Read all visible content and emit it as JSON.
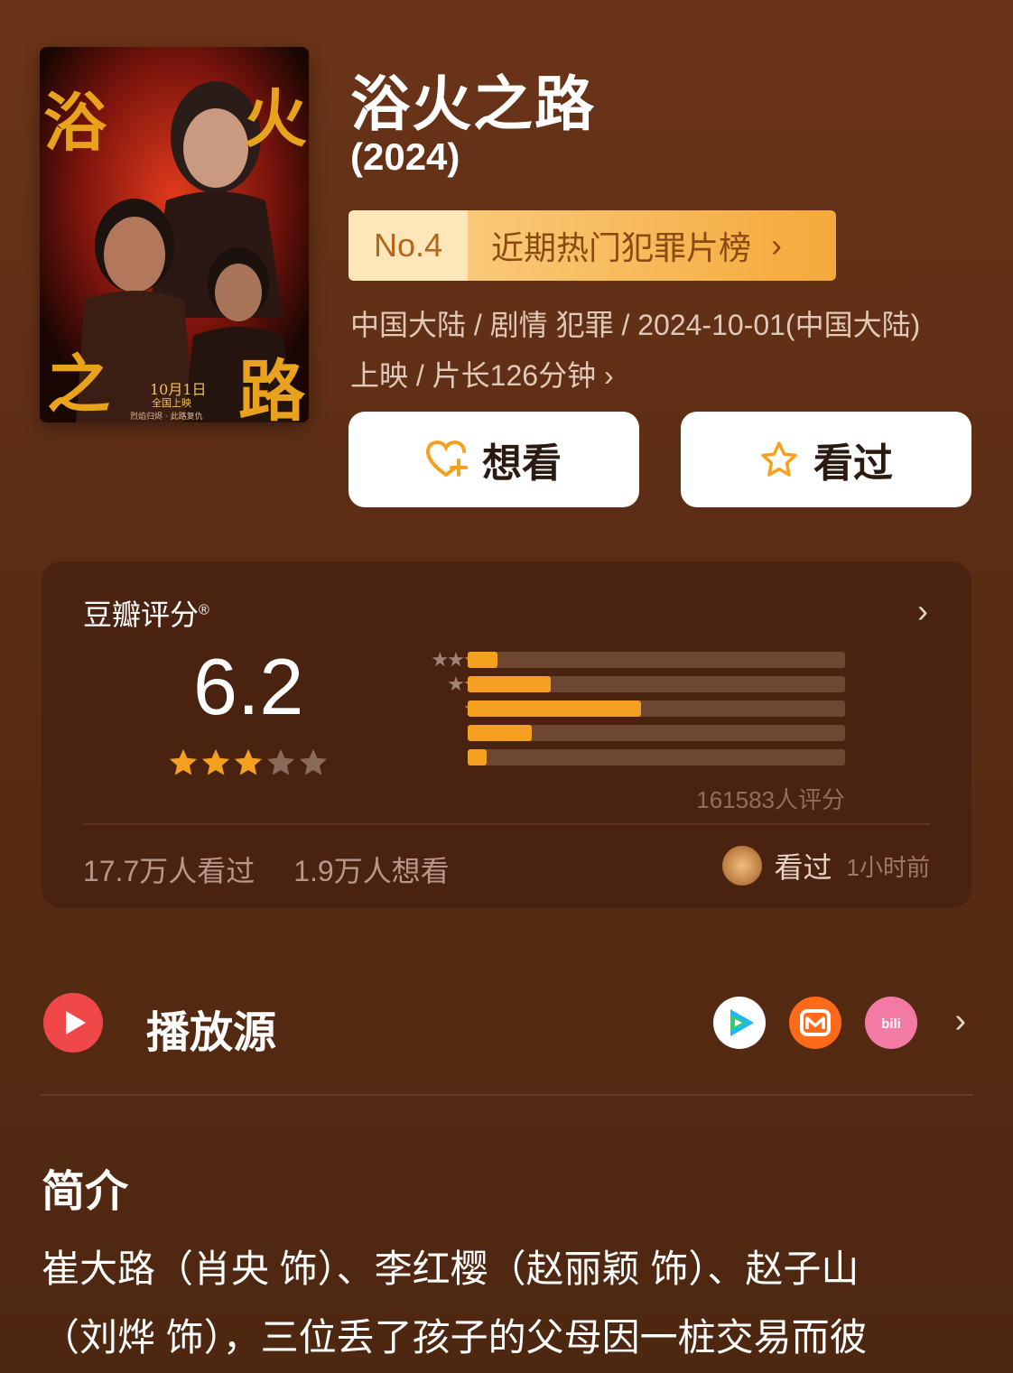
{
  "movie": {
    "title": "浴火之路",
    "year": "(2024)",
    "poster": {
      "title_chars": [
        "浴",
        "火",
        "之",
        "路"
      ],
      "date_text": "10月1日",
      "release_text": "全国上映",
      "slogan": "烈焰归烬 · 此路复仇"
    }
  },
  "rank": {
    "no": "No.4",
    "label": "近期热门犯罪片榜",
    "chevron": "›"
  },
  "meta": {
    "line1": "中国大陆 / 剧情 犯罪 / 2024-10-01(中国大陆)",
    "line2": "上映 / 片长126分钟 ›"
  },
  "actions": {
    "want": "想看",
    "seen": "看过",
    "want_icon": "heart-plus-icon",
    "seen_icon": "star-outline-icon"
  },
  "rating": {
    "label": "豆瓣评分",
    "registered": "®",
    "score": "6.2",
    "stars_filled": 3,
    "stars_total": 5,
    "distribution": [
      {
        "stars": "★★★★★",
        "percent": 8
      },
      {
        "stars": "★★★★",
        "percent": 22
      },
      {
        "stars": "★★★",
        "percent": 46
      },
      {
        "stars": "★★",
        "percent": 17
      },
      {
        "stars": "★",
        "percent": 5
      }
    ],
    "count": "161583人评分",
    "chevron": "›"
  },
  "stats": {
    "seen": "17.7万人看过",
    "want": "1.9万人想看",
    "friend_action": "看过",
    "friend_time": "1小时前"
  },
  "play": {
    "title": "播放源",
    "sources": [
      "tencent-video-icon",
      "mango-tv-icon",
      "bilibili-icon"
    ],
    "chevron": "›"
  },
  "intro": {
    "heading": "简介",
    "text_line1": "崔大路（肖央 饰）、李红樱（赵丽颖 饰）、赵子山",
    "text_line2": "（刘烨 饰），三位丢了孩子的父母因一桩交易而彼"
  },
  "colors": {
    "accent": "#f5a020",
    "play_red": "#f04848",
    "rank_text": "#8a4a12"
  }
}
